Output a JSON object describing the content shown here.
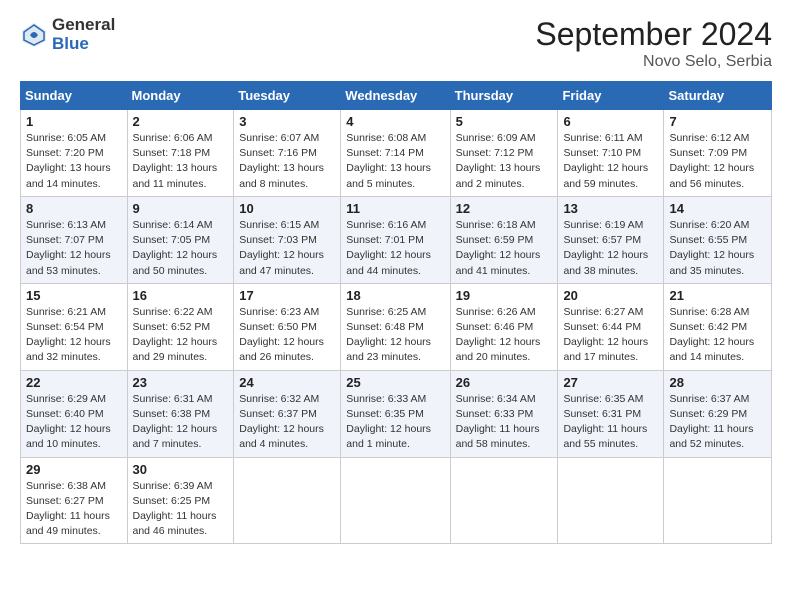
{
  "logo": {
    "general": "General",
    "blue": "Blue"
  },
  "header": {
    "month": "September 2024",
    "location": "Novo Selo, Serbia"
  },
  "weekdays": [
    "Sunday",
    "Monday",
    "Tuesday",
    "Wednesday",
    "Thursday",
    "Friday",
    "Saturday"
  ],
  "weeks": [
    [
      {
        "day": "1",
        "info": "Sunrise: 6:05 AM\nSunset: 7:20 PM\nDaylight: 13 hours\nand 14 minutes."
      },
      {
        "day": "2",
        "info": "Sunrise: 6:06 AM\nSunset: 7:18 PM\nDaylight: 13 hours\nand 11 minutes."
      },
      {
        "day": "3",
        "info": "Sunrise: 6:07 AM\nSunset: 7:16 PM\nDaylight: 13 hours\nand 8 minutes."
      },
      {
        "day": "4",
        "info": "Sunrise: 6:08 AM\nSunset: 7:14 PM\nDaylight: 13 hours\nand 5 minutes."
      },
      {
        "day": "5",
        "info": "Sunrise: 6:09 AM\nSunset: 7:12 PM\nDaylight: 13 hours\nand 2 minutes."
      },
      {
        "day": "6",
        "info": "Sunrise: 6:11 AM\nSunset: 7:10 PM\nDaylight: 12 hours\nand 59 minutes."
      },
      {
        "day": "7",
        "info": "Sunrise: 6:12 AM\nSunset: 7:09 PM\nDaylight: 12 hours\nand 56 minutes."
      }
    ],
    [
      {
        "day": "8",
        "info": "Sunrise: 6:13 AM\nSunset: 7:07 PM\nDaylight: 12 hours\nand 53 minutes."
      },
      {
        "day": "9",
        "info": "Sunrise: 6:14 AM\nSunset: 7:05 PM\nDaylight: 12 hours\nand 50 minutes."
      },
      {
        "day": "10",
        "info": "Sunrise: 6:15 AM\nSunset: 7:03 PM\nDaylight: 12 hours\nand 47 minutes."
      },
      {
        "day": "11",
        "info": "Sunrise: 6:16 AM\nSunset: 7:01 PM\nDaylight: 12 hours\nand 44 minutes."
      },
      {
        "day": "12",
        "info": "Sunrise: 6:18 AM\nSunset: 6:59 PM\nDaylight: 12 hours\nand 41 minutes."
      },
      {
        "day": "13",
        "info": "Sunrise: 6:19 AM\nSunset: 6:57 PM\nDaylight: 12 hours\nand 38 minutes."
      },
      {
        "day": "14",
        "info": "Sunrise: 6:20 AM\nSunset: 6:55 PM\nDaylight: 12 hours\nand 35 minutes."
      }
    ],
    [
      {
        "day": "15",
        "info": "Sunrise: 6:21 AM\nSunset: 6:54 PM\nDaylight: 12 hours\nand 32 minutes."
      },
      {
        "day": "16",
        "info": "Sunrise: 6:22 AM\nSunset: 6:52 PM\nDaylight: 12 hours\nand 29 minutes."
      },
      {
        "day": "17",
        "info": "Sunrise: 6:23 AM\nSunset: 6:50 PM\nDaylight: 12 hours\nand 26 minutes."
      },
      {
        "day": "18",
        "info": "Sunrise: 6:25 AM\nSunset: 6:48 PM\nDaylight: 12 hours\nand 23 minutes."
      },
      {
        "day": "19",
        "info": "Sunrise: 6:26 AM\nSunset: 6:46 PM\nDaylight: 12 hours\nand 20 minutes."
      },
      {
        "day": "20",
        "info": "Sunrise: 6:27 AM\nSunset: 6:44 PM\nDaylight: 12 hours\nand 17 minutes."
      },
      {
        "day": "21",
        "info": "Sunrise: 6:28 AM\nSunset: 6:42 PM\nDaylight: 12 hours\nand 14 minutes."
      }
    ],
    [
      {
        "day": "22",
        "info": "Sunrise: 6:29 AM\nSunset: 6:40 PM\nDaylight: 12 hours\nand 10 minutes."
      },
      {
        "day": "23",
        "info": "Sunrise: 6:31 AM\nSunset: 6:38 PM\nDaylight: 12 hours\nand 7 minutes."
      },
      {
        "day": "24",
        "info": "Sunrise: 6:32 AM\nSunset: 6:37 PM\nDaylight: 12 hours\nand 4 minutes."
      },
      {
        "day": "25",
        "info": "Sunrise: 6:33 AM\nSunset: 6:35 PM\nDaylight: 12 hours\nand 1 minute."
      },
      {
        "day": "26",
        "info": "Sunrise: 6:34 AM\nSunset: 6:33 PM\nDaylight: 11 hours\nand 58 minutes."
      },
      {
        "day": "27",
        "info": "Sunrise: 6:35 AM\nSunset: 6:31 PM\nDaylight: 11 hours\nand 55 minutes."
      },
      {
        "day": "28",
        "info": "Sunrise: 6:37 AM\nSunset: 6:29 PM\nDaylight: 11 hours\nand 52 minutes."
      }
    ],
    [
      {
        "day": "29",
        "info": "Sunrise: 6:38 AM\nSunset: 6:27 PM\nDaylight: 11 hours\nand 49 minutes."
      },
      {
        "day": "30",
        "info": "Sunrise: 6:39 AM\nSunset: 6:25 PM\nDaylight: 11 hours\nand 46 minutes."
      },
      {
        "day": "",
        "info": ""
      },
      {
        "day": "",
        "info": ""
      },
      {
        "day": "",
        "info": ""
      },
      {
        "day": "",
        "info": ""
      },
      {
        "day": "",
        "info": ""
      }
    ]
  ]
}
